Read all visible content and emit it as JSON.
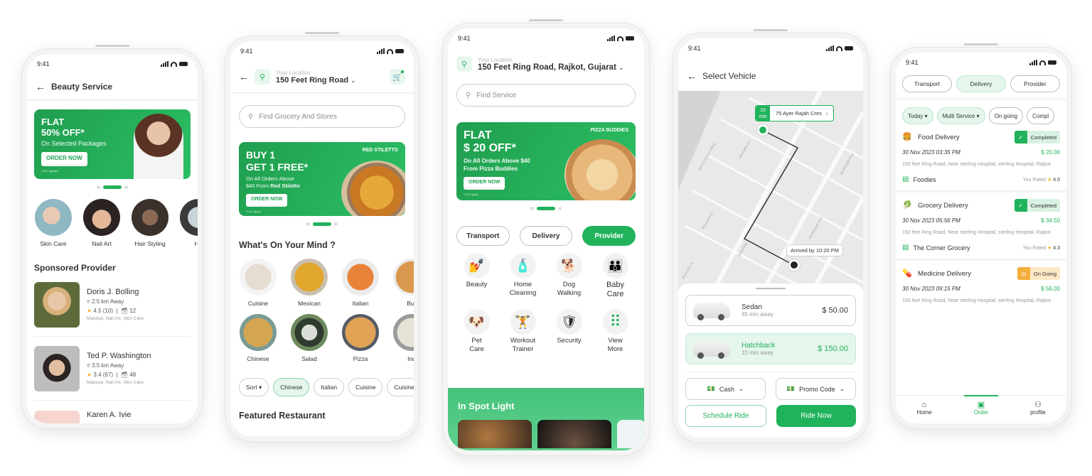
{
  "status_time": "9:41",
  "colors": {
    "accent": "#21b35b",
    "accent_light": "#e5f6ec",
    "ongoing": "#f3ae3b",
    "rating_star": "#f2b81f"
  },
  "beauty": {
    "title": "Beauty Service",
    "banner": {
      "line1": "FLAT",
      "line2": "50% OFF*",
      "sub": "On Selected Packages",
      "cta": "ORDER NOW",
      "tc": "*T&C Applied"
    },
    "categories": [
      {
        "label": "Skin Care"
      },
      {
        "label": "Nail Art"
      },
      {
        "label": "Hair Styling"
      },
      {
        "label": "Ha"
      }
    ],
    "section_title": "Sponsored Provider",
    "providers": [
      {
        "name": "Doris J. Bolling",
        "distance": "2.5 km Away",
        "rating": "4.5 (10)",
        "jobs": "12",
        "tags": "Makeup, Nail Art, Skin Care"
      },
      {
        "name": "Ted P. Washington",
        "distance": "3.5 km Away",
        "rating": "3.4 (67)",
        "jobs": "48",
        "tags": "Makeup, Nail Art, Skin Care"
      },
      {
        "name": "Karen A. Ivie"
      }
    ]
  },
  "grocery": {
    "location_label": "Your Location",
    "location_value": "150 Feet Ring Road",
    "search_placeholder": "Find Grocery And Stores",
    "banner": {
      "line1": "BUY 1",
      "line2": "GET 1 FREE*",
      "sub1": "On All Orders Above",
      "sub2_prefix": "$40 From ",
      "sub2_bold": "Red Stiletto",
      "cta": "ORDER NOW",
      "tc": "*T&C Apply",
      "brand": "RED STILETTO"
    },
    "section_title": "What's On Your Mind ?",
    "row1": [
      {
        "label": "Cuisine"
      },
      {
        "label": "Mexican"
      },
      {
        "label": "Italian"
      },
      {
        "label": "Bur"
      }
    ],
    "row2": [
      {
        "label": "Chinese"
      },
      {
        "label": "Salad"
      },
      {
        "label": "Pizza"
      },
      {
        "label": "Ind"
      }
    ],
    "chips": [
      {
        "label": "Sort ▾"
      },
      {
        "label": "Chinese"
      },
      {
        "label": "Italian"
      },
      {
        "label": "Cuisine"
      },
      {
        "label": "Cuisine"
      }
    ],
    "selected_chip": "Chinese",
    "featured_title": "Featured Restaurant"
  },
  "home": {
    "location_label": "Your Location",
    "location_value": "150 Feet Ring Road, Rajkot, Gujarat",
    "search_placeholder": "Find Service",
    "banner": {
      "line1": "FLAT",
      "line2": "$ 20 OFF*",
      "sub1": "On All Orders Above $40",
      "sub2": "From Pizza Buddies",
      "cta": "ORDER NOW",
      "tc": "*T&C Apply",
      "brand": "PIZZA BUDDIES"
    },
    "tabs": [
      {
        "label": "Transport"
      },
      {
        "label": "Delivery"
      },
      {
        "label": "Provider"
      }
    ],
    "active_tab": "Provider",
    "services": [
      {
        "label": "Beauty",
        "icon": "💅"
      },
      {
        "label": "Home Cleaning",
        "icon": "🧴"
      },
      {
        "label": "Dog Walking",
        "icon": "🐕"
      },
      {
        "label": "Baby Care",
        "icon": "👪"
      },
      {
        "label": "Pet Care",
        "icon": "🐶"
      },
      {
        "label": "Workout Trainer",
        "icon": "🏋"
      },
      {
        "label": "Security",
        "icon": "🛡"
      },
      {
        "label": "View More",
        "icon": "⠿"
      }
    ],
    "spotlight_title": "In Spot Light"
  },
  "vehicle": {
    "title": "Select Vehicle",
    "eta_value": "10",
    "eta_unit": "min",
    "destination": "75 Ayer Rajah Cres",
    "arrival": "Arrived by 10:20 PM",
    "map_streets": [
      "Henry Hudson Pkwy",
      "Riverside Dr",
      "Riverside Dr",
      "Broadway",
      "Amsterdam Ave",
      "Amsterdam Ave",
      "Riverside Dr"
    ],
    "options": [
      {
        "name": "Sedan",
        "eta": "45 min away",
        "price": "$ 50.00"
      },
      {
        "name": "Hatchback",
        "eta": "10 min away",
        "price": "$ 150.00"
      }
    ],
    "selected_option": "Hatchback",
    "payment": "Cash",
    "promo": "Promo Code",
    "schedule_label": "Schedule Ride",
    "ride_now_label": "Ride Now"
  },
  "orders": {
    "segments": [
      {
        "label": "Transport"
      },
      {
        "label": "Delivery"
      },
      {
        "label": "Provider"
      }
    ],
    "active_segment": "Delivery",
    "filters": [
      {
        "label": "Today ▾"
      },
      {
        "label": "Multi Service ▾"
      },
      {
        "label": "On going"
      },
      {
        "label": "Compl"
      }
    ],
    "list": [
      {
        "title": "Food Delivery",
        "icon": "🍔",
        "status": "Completed",
        "date": "30 Nov  2023  03:35 PM",
        "price": "$ 20.00",
        "address": "150 feet Ring Road, Near sterling Hospital, sterling Hospital, Rajkot",
        "store": "Foodies",
        "rated_label": "You Rated",
        "rating": "4.0"
      },
      {
        "title": "Grocery Delivery",
        "icon": "🥬",
        "status": "Completed",
        "date": "30 Nov  2023  05:56 PM",
        "price": "$ 34.50",
        "address": "150 feet Ring Road, Near sterling Hospital, sterling Hospital, Rajkot",
        "store": "The Corner Grocery",
        "rated_label": "You Rated",
        "rating": "4.3"
      },
      {
        "title": "Medicine Delivery",
        "icon": "💊",
        "status": "On Going",
        "date": "30 Nov  2023  09:15 PM",
        "price": "$ 56.00",
        "address": "150 feet Ring Road, Near sterling Hospital, sterling Hospital, Rajkot"
      }
    ],
    "nav": [
      {
        "label": "Home"
      },
      {
        "label": "Order"
      },
      {
        "label": "profile"
      }
    ],
    "active_nav": "Order"
  }
}
